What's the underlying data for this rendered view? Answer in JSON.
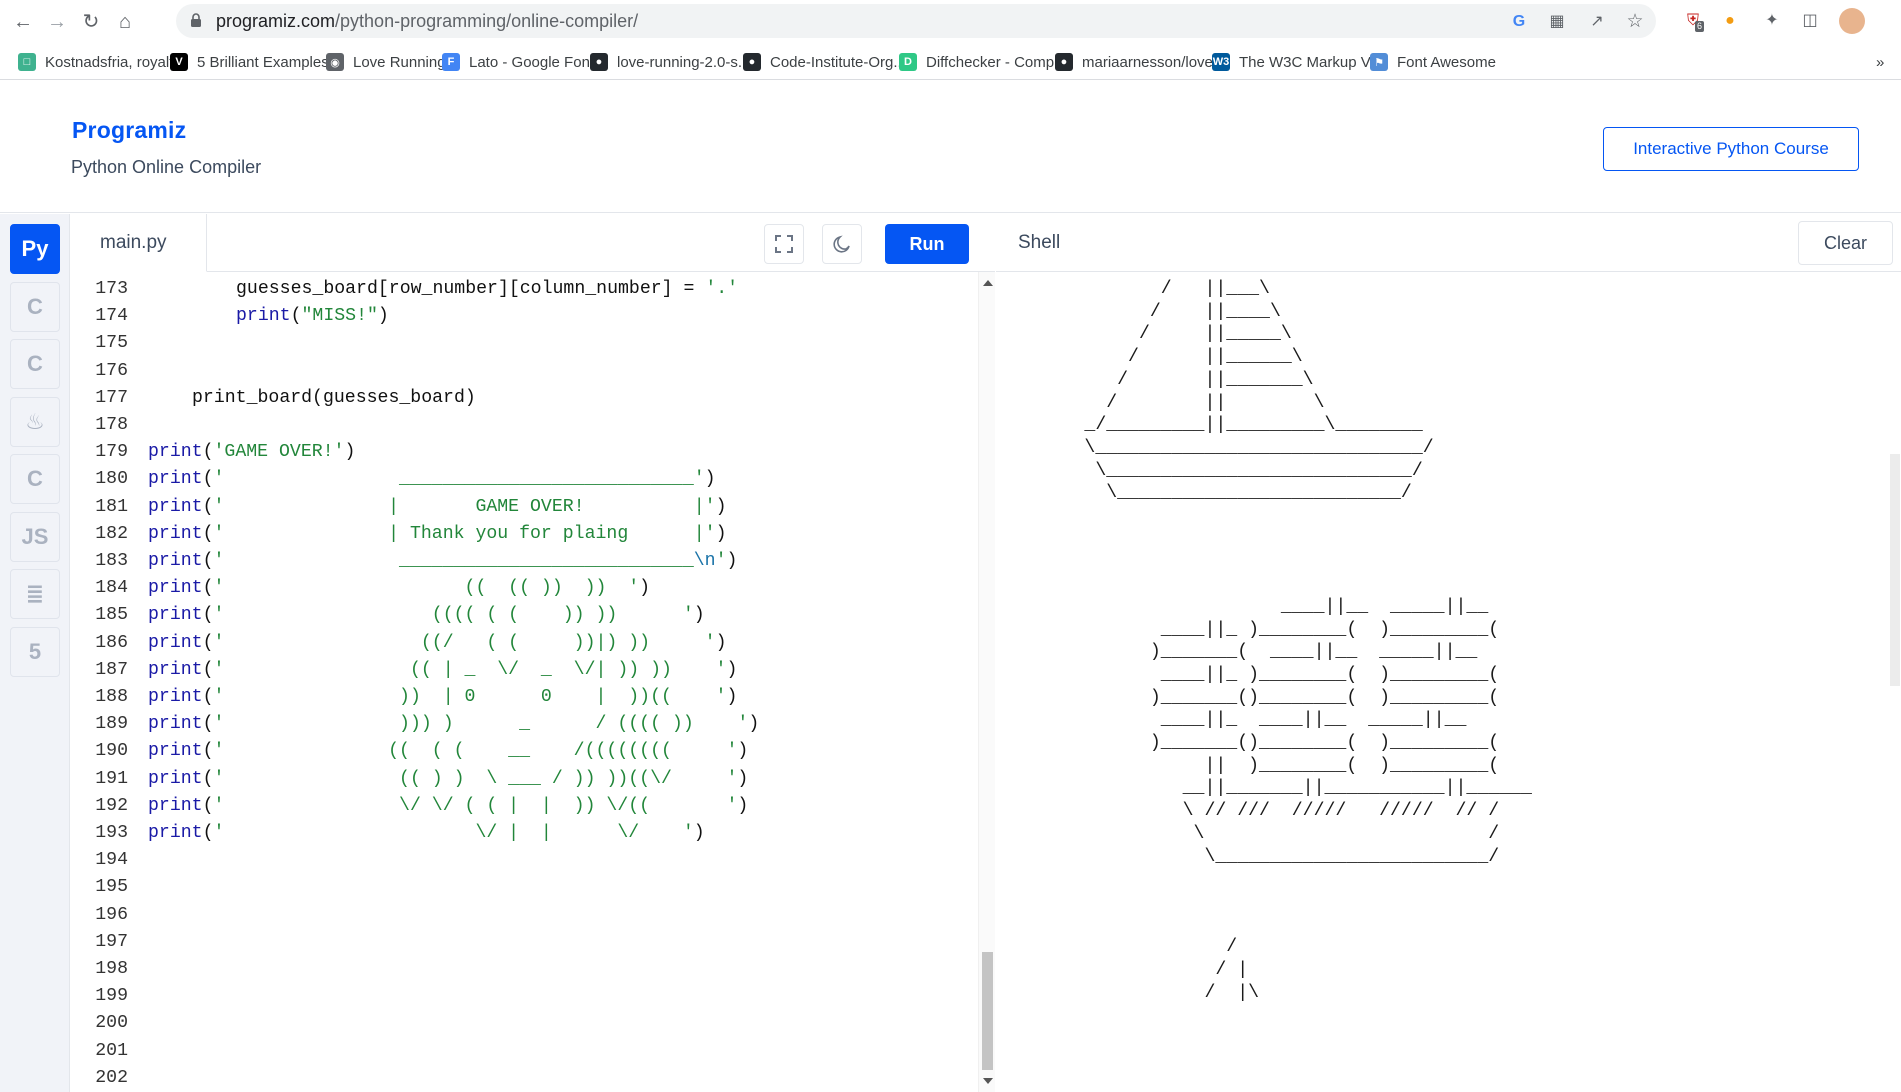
{
  "browser": {
    "url_host": "programiz.com",
    "url_path": "/python-programming/online-compiler/",
    "bookmarks": [
      {
        "label": "Kostnadsfria, royalt...",
        "icon": "unsplash-favicon",
        "color": "#3fb28f",
        "glyph": "□"
      },
      {
        "label": "5 Brilliant Examples...",
        "icon": "v-favicon",
        "color": "#000000",
        "glyph": "V"
      },
      {
        "label": "Love Running",
        "icon": "globe-favicon",
        "color": "#5f6368",
        "glyph": "◉"
      },
      {
        "label": "Lato - Google Fonts",
        "icon": "google-fonts-favicon",
        "color": "#4285f4",
        "glyph": "F"
      },
      {
        "label": "love-running-2.0-s...",
        "icon": "github-favicon",
        "color": "#24292e",
        "glyph": "●"
      },
      {
        "label": "Code-Institute-Org...",
        "icon": "github-favicon",
        "color": "#24292e",
        "glyph": "●"
      },
      {
        "label": "Diffchecker - Comp...",
        "icon": "diffchecker-favicon",
        "color": "#2fc886",
        "glyph": "D"
      },
      {
        "label": "mariaarnesson/love...",
        "icon": "github-favicon",
        "color": "#24292e",
        "glyph": "●"
      },
      {
        "label": "The W3C Markup V...",
        "icon": "w3c-favicon",
        "color": "#005a9c",
        "glyph": "W3"
      },
      {
        "label": "Font Awesome",
        "icon": "flag-favicon",
        "color": "#528dd7",
        "glyph": "⚑"
      }
    ],
    "more": "»",
    "badge_count": "6"
  },
  "header": {
    "logo": "Programiz",
    "subtitle": "Python Online Compiler",
    "course_button": "Interactive Python Course"
  },
  "rail": [
    {
      "name": "python",
      "glyph": "Py",
      "active": true
    },
    {
      "name": "c",
      "glyph": "C",
      "active": false
    },
    {
      "name": "cpp",
      "glyph": "C",
      "active": false
    },
    {
      "name": "java",
      "glyph": "♨",
      "active": false
    },
    {
      "name": "csharp",
      "glyph": "C",
      "active": false
    },
    {
      "name": "javascript",
      "glyph": "JS",
      "active": false
    },
    {
      "name": "sql",
      "glyph": "≣",
      "active": false
    },
    {
      "name": "html",
      "glyph": "5",
      "active": false
    }
  ],
  "editor": {
    "file_tab": "main.py",
    "run_label": "Run",
    "lines": [
      {
        "n": "173",
        "indent": 8,
        "segs": [
          [
            "t",
            "guesses_board[row_number][column_number] = "
          ],
          [
            "s",
            "'.'"
          ]
        ]
      },
      {
        "n": "174",
        "indent": 8,
        "segs": [
          [
            "k",
            "print"
          ],
          [
            "t",
            "("
          ],
          [
            "s",
            "\"MISS!\""
          ],
          [
            "t",
            ")"
          ]
        ]
      },
      {
        "n": "175",
        "indent": 0,
        "segs": []
      },
      {
        "n": "176",
        "indent": 0,
        "segs": []
      },
      {
        "n": "177",
        "indent": 4,
        "segs": [
          [
            "t",
            "print_board(guesses_board)"
          ]
        ]
      },
      {
        "n": "178",
        "indent": 0,
        "segs": []
      },
      {
        "n": "179",
        "indent": 0,
        "segs": [
          [
            "k",
            "print"
          ],
          [
            "t",
            "("
          ],
          [
            "s",
            "'GAME OVER!'"
          ],
          [
            "t",
            ")"
          ]
        ]
      },
      {
        "n": "180",
        "indent": 0,
        "segs": [
          [
            "k",
            "print"
          ],
          [
            "t",
            "("
          ],
          [
            "s",
            "'                ___________________________'"
          ],
          [
            "t",
            ")"
          ]
        ]
      },
      {
        "n": "181",
        "indent": 0,
        "segs": [
          [
            "k",
            "print"
          ],
          [
            "t",
            "("
          ],
          [
            "s",
            "'               |       GAME OVER!          |'"
          ],
          [
            "t",
            ")"
          ]
        ]
      },
      {
        "n": "182",
        "indent": 0,
        "segs": [
          [
            "k",
            "print"
          ],
          [
            "t",
            "("
          ],
          [
            "s",
            "'               | Thank you for plaing      |'"
          ],
          [
            "t",
            ")"
          ]
        ]
      },
      {
        "n": "183",
        "indent": 0,
        "segs": [
          [
            "k",
            "print"
          ],
          [
            "t",
            "("
          ],
          [
            "s",
            "'                ___________________________"
          ],
          [
            "e",
            "\\n"
          ],
          [
            "s",
            "'"
          ],
          [
            "t",
            ")"
          ]
        ]
      },
      {
        "n": "184",
        "indent": 0,
        "segs": [
          [
            "k",
            "print"
          ],
          [
            "t",
            "("
          ],
          [
            "s",
            "'                      ((  (( ))  ))  '"
          ],
          [
            "t",
            ")"
          ]
        ]
      },
      {
        "n": "185",
        "indent": 0,
        "segs": [
          [
            "k",
            "print"
          ],
          [
            "t",
            "("
          ],
          [
            "s",
            "'                   (((( ( (    )) ))      '"
          ],
          [
            "t",
            ")"
          ]
        ]
      },
      {
        "n": "186",
        "indent": 0,
        "segs": [
          [
            "k",
            "print"
          ],
          [
            "t",
            "("
          ],
          [
            "s",
            "'                  ((/   ( (     ))|) ))     '"
          ],
          [
            "t",
            ")"
          ]
        ]
      },
      {
        "n": "187",
        "indent": 0,
        "segs": [
          [
            "k",
            "print"
          ],
          [
            "t",
            "("
          ],
          [
            "s",
            "'                 (( | _  \\/  _  \\/| )) ))    '"
          ],
          [
            "t",
            ")"
          ]
        ]
      },
      {
        "n": "188",
        "indent": 0,
        "segs": [
          [
            "k",
            "print"
          ],
          [
            "t",
            "("
          ],
          [
            "s",
            "'                ))  | 0      0    |  ))((    '"
          ],
          [
            "t",
            ")"
          ]
        ]
      },
      {
        "n": "189",
        "indent": 0,
        "segs": [
          [
            "k",
            "print"
          ],
          [
            "t",
            "("
          ],
          [
            "s",
            "'                ))) )      _      / (((( ))    '"
          ],
          [
            "t",
            ")"
          ]
        ]
      },
      {
        "n": "190",
        "indent": 0,
        "segs": [
          [
            "k",
            "print"
          ],
          [
            "t",
            "("
          ],
          [
            "s",
            "'               ((  ( (    __    /((((((((     '"
          ],
          [
            "t",
            ")"
          ]
        ]
      },
      {
        "n": "191",
        "indent": 0,
        "segs": [
          [
            "k",
            "print"
          ],
          [
            "t",
            "("
          ],
          [
            "s",
            "'                (( ) )  \\ ___ / )) ))((\\/     '"
          ],
          [
            "t",
            ")"
          ]
        ]
      },
      {
        "n": "192",
        "indent": 0,
        "segs": [
          [
            "k",
            "print"
          ],
          [
            "t",
            "("
          ],
          [
            "s",
            "'                \\/ \\/ ( ( |  |  )) \\/((       '"
          ],
          [
            "t",
            ")"
          ]
        ]
      },
      {
        "n": "193",
        "indent": 0,
        "segs": [
          [
            "k",
            "print"
          ],
          [
            "t",
            "("
          ],
          [
            "s",
            "'                       \\/ |  |      \\/    '"
          ],
          [
            "t",
            ")"
          ]
        ]
      },
      {
        "n": "194",
        "indent": 0,
        "segs": []
      },
      {
        "n": "195",
        "indent": 0,
        "segs": []
      },
      {
        "n": "196",
        "indent": 0,
        "segs": []
      },
      {
        "n": "197",
        "indent": 0,
        "segs": []
      },
      {
        "n": "198",
        "indent": 0,
        "segs": []
      },
      {
        "n": "199",
        "indent": 0,
        "segs": []
      },
      {
        "n": "200",
        "indent": 0,
        "segs": []
      },
      {
        "n": "201",
        "indent": 0,
        "segs": []
      },
      {
        "n": "202",
        "indent": 0,
        "segs": []
      }
    ]
  },
  "shell": {
    "title": "Shell",
    "clear_label": "Clear",
    "lines": [
      "              /   ||___\\",
      "             /    ||____\\",
      "            /     ||_____\\",
      "           /      ||______\\",
      "          /       ||_______\\",
      "         /        ||        \\",
      "       _/_________||_________\\________",
      "       \\______________________________/",
      "        \\____________________________/",
      "         \\__________________________/",
      "",
      "",
      "",
      "",
      "                         ____||__  _____||__",
      "              ____||_ )________(  )_________(",
      "             )_______(  ____||__  _____||__",
      "              ____||_ )________(  )_________(",
      "             )_______()________(  )_________(",
      "              ____||_  ____||__  _____||__",
      "             )_______()________(  )_________(",
      "                  ||  )________(  )_________(",
      "                __||_______||___________||______",
      "                \\ // ///  /////   /////  // /",
      "                 \\                          /",
      "                  \\_________________________/",
      "",
      "",
      "",
      "                    /",
      "                   / |",
      "                  /  |\\"
    ]
  }
}
